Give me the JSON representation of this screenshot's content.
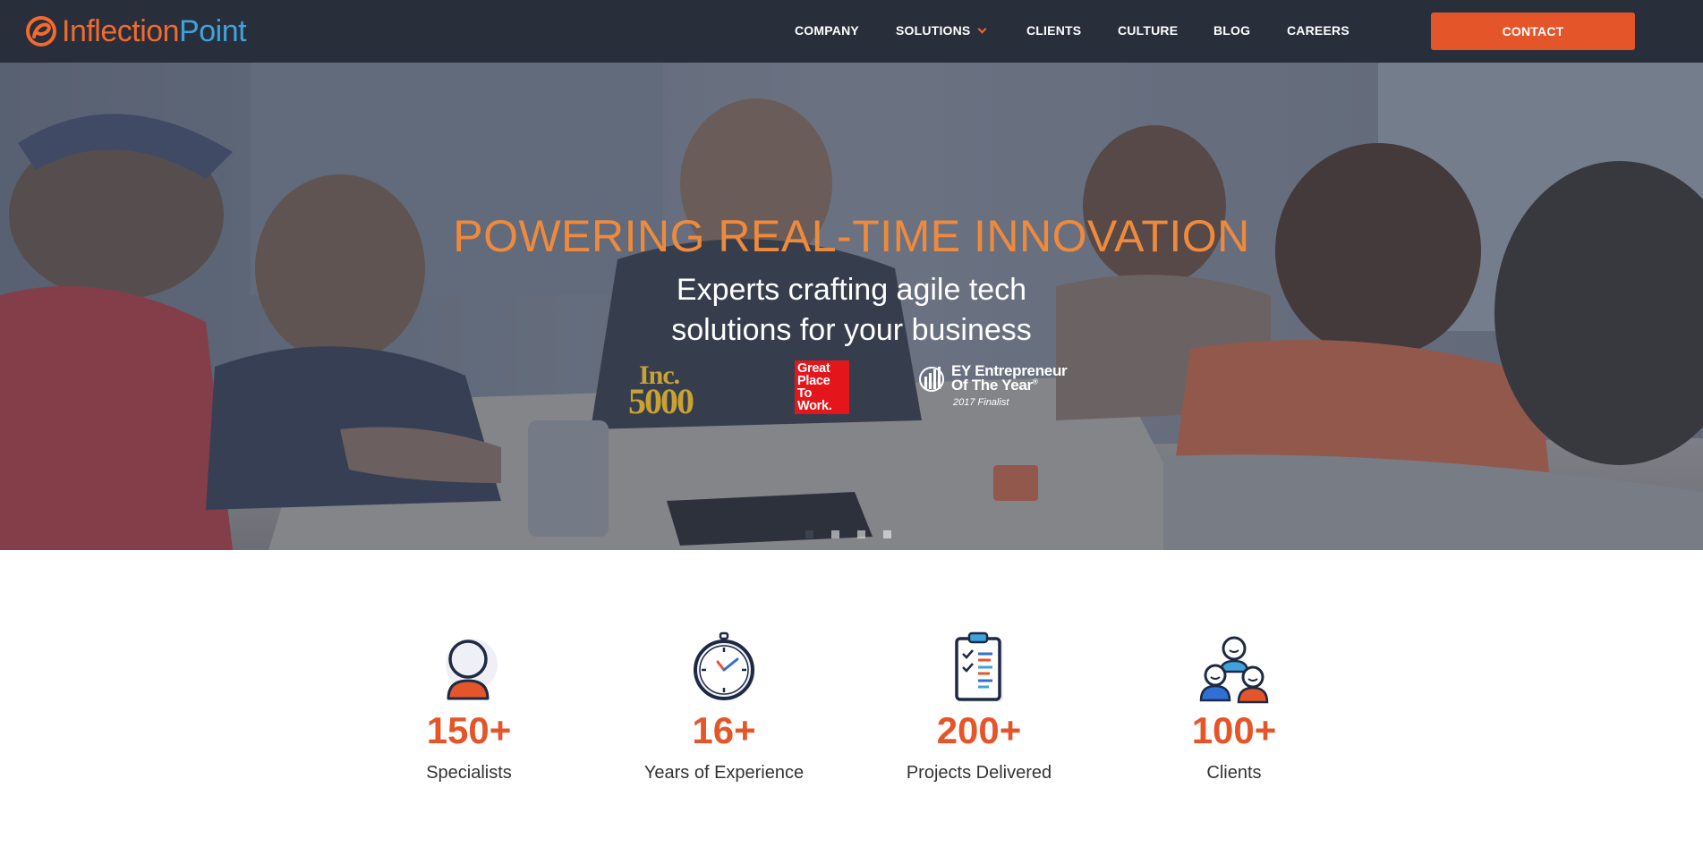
{
  "brand": {
    "name_part1": "Inflection",
    "name_part2": "Point",
    "colors": {
      "orange": "#f26a2e",
      "blue": "#3ea3dc",
      "nav_bg": "#292e3b",
      "cta": "#e4562a"
    }
  },
  "nav": {
    "items": [
      {
        "label": "COMPANY"
      },
      {
        "label": "SOLUTIONS",
        "has_dropdown": true
      },
      {
        "label": "CLIENTS"
      },
      {
        "label": "CULTURE"
      },
      {
        "label": "BLOG"
      },
      {
        "label": "CAREERS"
      }
    ],
    "contact_label": "CONTACT"
  },
  "hero": {
    "title": "POWERING REAL-TIME INNOVATION",
    "subtitle_line1": "Experts crafting agile tech",
    "subtitle_line2": "solutions for your business",
    "awards": {
      "inc_top": "Inc.",
      "inc_bottom": "5000",
      "gptw": [
        "Great",
        "Place",
        "To",
        "Work."
      ],
      "ey_line1": "EY Entrepreneur",
      "ey_line2": "Of The Year",
      "ey_line3": "2017 Finalist"
    },
    "slider": {
      "total": 4,
      "active": 1
    }
  },
  "stats": [
    {
      "value": "150+",
      "label": "Specialists",
      "icon": "person-icon"
    },
    {
      "value": "16+",
      "label": "Years of Experience",
      "icon": "stopwatch-icon"
    },
    {
      "value": "200+",
      "label": "Projects Delivered",
      "icon": "clipboard-checklist-icon"
    },
    {
      "value": "100+",
      "label": "Clients",
      "icon": "group-icon"
    }
  ]
}
